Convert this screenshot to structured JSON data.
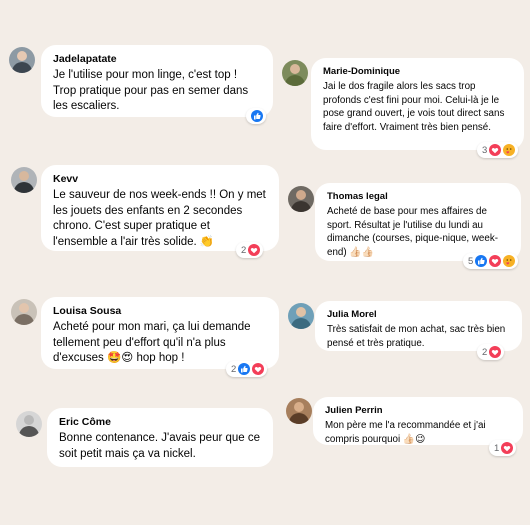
{
  "comments": [
    {
      "author": "Jadelapatate",
      "text": "Je l'utilise pour mon linge, c'est top ! Trop pratique pour pas en semer dans les escaliers.",
      "reactions": {
        "count": "",
        "icons": [
          "like-icon"
        ]
      }
    },
    {
      "author": "Marie-Dominique",
      "text": "Jai le dos fragile alors les sacs trop profonds c'est fini pour moi. Celui-là je le pose grand ouvert, je vois tout direct sans faire d'effort. Vraiment très bien pensé.",
      "reactions": {
        "count": "3",
        "icons": [
          "love-icon",
          "care-icon"
        ]
      }
    },
    {
      "author": "Kevv",
      "text": "Le sauveur de nos week-ends !! On y met les jouets des enfants en 2 secondes chrono. C'est super pratique et l'ensemble a l'air très solide. 👏",
      "reactions": {
        "count": "2",
        "icons": [
          "love-icon"
        ]
      }
    },
    {
      "author": "Thomas legal",
      "text": "Acheté de base pour mes affaires de sport. Résultat je l'utilise du lundi au dimanche (courses, pique-nique, week-end) 👍🏻👍🏻",
      "reactions": {
        "count": "5",
        "icons": [
          "like-icon",
          "love-icon",
          "care-icon"
        ]
      }
    },
    {
      "author": "Louisa Sousa",
      "text": "Acheté pour mon mari, ça lui demande tellement peu d'effort qu'il n'a plus d'excuses 🤩😍 hop hop !",
      "reactions": {
        "count": "2",
        "icons": [
          "like-icon",
          "love-icon"
        ]
      }
    },
    {
      "author": "Julia Morel",
      "text": "Très satisfait de mon achat, sac très bien pensé et très pratique.",
      "reactions": {
        "count": "2",
        "icons": [
          "love-icon"
        ]
      }
    },
    {
      "author": "Eric Côme",
      "text": "Bonne contenance. J'avais peur que ce soit petit mais ça va nickel.",
      "reactions": null
    },
    {
      "author": "Julien Perrin",
      "text": "Mon père me l'a recommandée et j'ai compris pourquoi 👍🏻😉",
      "reactions": {
        "count": "1",
        "icons": [
          "love-icon"
        ]
      }
    }
  ],
  "colors": {
    "background": "#f3ede7",
    "bubble": "#ffffff",
    "like": "#1877f2",
    "love": "#f33e58",
    "care": "#f7b125"
  }
}
